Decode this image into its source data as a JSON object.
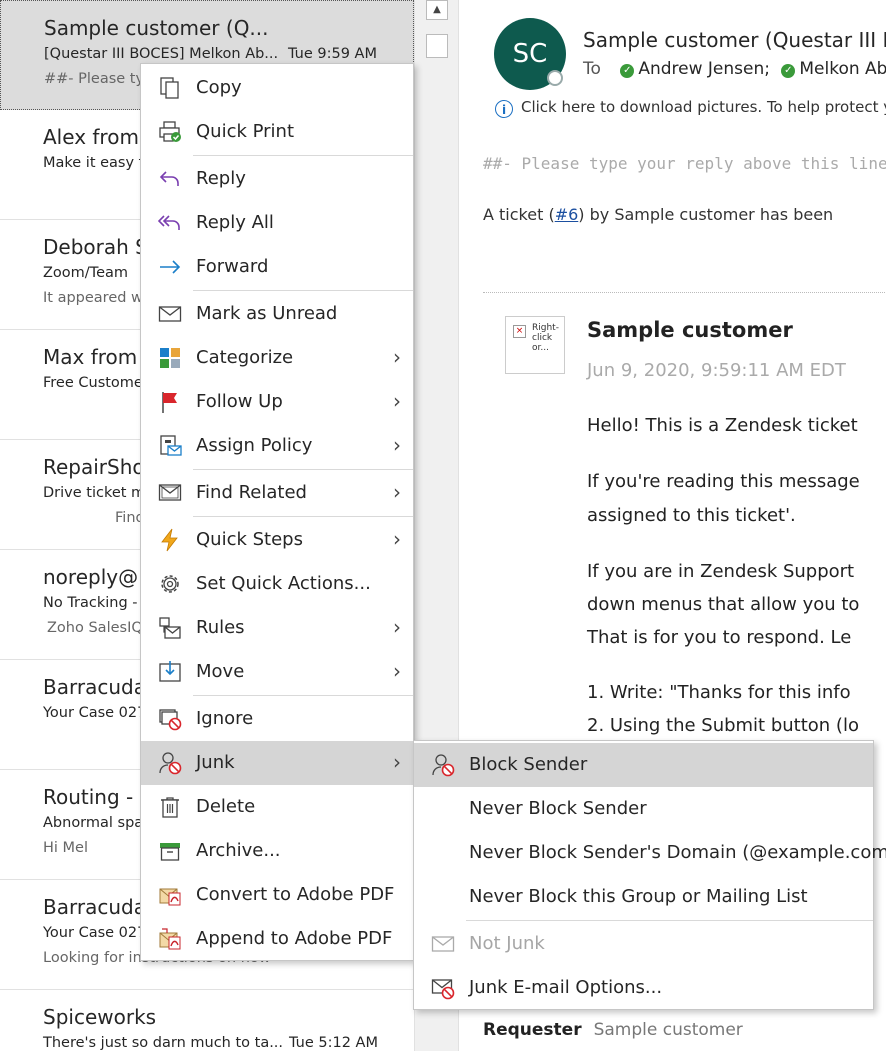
{
  "messages": [
    {
      "sender": "Sample customer (Q...",
      "subject": "[Questar III BOCES] Melkon Ab...",
      "time": "Tue 9:59 AM",
      "preview": "##- Please typ",
      "selected": true
    },
    {
      "sender": "Alex from",
      "subject": "Make it easy f",
      "time": "",
      "preview": ""
    },
    {
      "sender": "Deborah S",
      "subject": "Zoom/Team",
      "time": "",
      "preview": "It appeared wh"
    },
    {
      "sender": "Max from",
      "subject": "Free Custome",
      "time": "",
      "preview": ""
    },
    {
      "sender": "RepairSho",
      "subject": "Drive ticket m",
      "time": "",
      "preview": "Find"
    },
    {
      "sender": "noreply@",
      "subject": "No Tracking -",
      "time": "",
      "preview": "Zoho SalesIQ"
    },
    {
      "sender": "Barracuda",
      "subject": "Your Case 027",
      "time": "",
      "preview": ""
    },
    {
      "sender": "Routing -",
      "subject": "Abnormal spa",
      "time": "",
      "preview": "Hi Mel"
    },
    {
      "sender": "Barracuda",
      "subject": "Your Case 027",
      "time": "",
      "preview": "Looking for instructions on how"
    },
    {
      "sender": "Spiceworks",
      "subject": "There's just so darn much to ta...",
      "time": "Tue 5:12 AM",
      "preview": ""
    }
  ],
  "reading": {
    "avatar_initials": "SC",
    "from": "Sample customer (Questar III BOCES)",
    "to_label": "To",
    "recipients": [
      "Andrew Jensen;",
      "Melkon Abdo"
    ],
    "info_text": "Click here to download pictures. To help protect your privacy",
    "reply_line": "##- Please type your reply above this line -##",
    "ticket_prefix": "A ticket (",
    "ticket_link": "#6",
    "ticket_suffix": ") by Sample customer has been",
    "image_placeholder": "Right-click or...",
    "sender_name": "Sample customer",
    "sent_date": "Jun 9, 2020, 9:59:11 AM EDT",
    "body": [
      "Hello! This is a Zendesk ticket",
      "If you're reading this message",
      "assigned to this ticket'.",
      "If you are in Zendesk Support",
      "down menus that allow you to",
      "That is for you to respond. Le",
      "1. Write: \"Thanks for this info",
      "2. Using the Submit button (lo"
    ],
    "requester_label": "Requester",
    "requester_value": "Sample customer"
  },
  "context_menu": [
    {
      "label": "Copy",
      "icon": "copy-icon"
    },
    {
      "label": "Quick Print",
      "icon": "quick-print-icon"
    },
    {
      "label": "Reply",
      "icon": "reply-icon"
    },
    {
      "label": "Reply All",
      "icon": "reply-all-icon"
    },
    {
      "label": "Forward",
      "icon": "forward-icon"
    },
    {
      "label": "Mark as Unread",
      "icon": "mark-unread-icon"
    },
    {
      "label": "Categorize",
      "icon": "categorize-icon",
      "submenu": true
    },
    {
      "label": "Follow Up",
      "icon": "follow-up-flag-icon",
      "submenu": true
    },
    {
      "label": "Assign Policy",
      "icon": "assign-policy-icon",
      "submenu": true
    },
    {
      "label": "Find Related",
      "icon": "find-related-icon",
      "submenu": true
    },
    {
      "label": "Quick Steps",
      "icon": "quick-steps-icon",
      "submenu": true
    },
    {
      "label": "Set Quick Actions...",
      "icon": "gear-icon"
    },
    {
      "label": "Rules",
      "icon": "rules-icon",
      "submenu": true
    },
    {
      "label": "Move",
      "icon": "move-icon",
      "submenu": true
    },
    {
      "label": "Ignore",
      "icon": "ignore-icon"
    },
    {
      "label": "Junk",
      "icon": "junk-icon",
      "submenu": true,
      "hover": true
    },
    {
      "label": "Delete",
      "icon": "delete-icon"
    },
    {
      "label": "Archive...",
      "icon": "archive-icon"
    },
    {
      "label": "Convert to Adobe PDF",
      "icon": "adobe-pdf-icon"
    },
    {
      "label": "Append to Adobe PDF",
      "icon": "adobe-pdf-append-icon"
    }
  ],
  "junk_menu": [
    {
      "label": "Block Sender",
      "icon": "block-sender-icon",
      "hover": true
    },
    {
      "label": "Never Block Sender",
      "icon": ""
    },
    {
      "label": "Never Block Sender's Domain (@example.com)",
      "icon": ""
    },
    {
      "label": "Never Block this Group or Mailing List",
      "icon": ""
    },
    {
      "label": "Not Junk",
      "icon": "not-junk-icon",
      "disabled": true
    },
    {
      "label": "Junk E-mail Options...",
      "icon": "junk-options-icon"
    }
  ],
  "colors": {
    "avatar_bg": "#0e5a4e",
    "presence_ok": "#3a9a3a",
    "link": "#1b4fa0",
    "hover_bg": "#d5d5d5"
  }
}
